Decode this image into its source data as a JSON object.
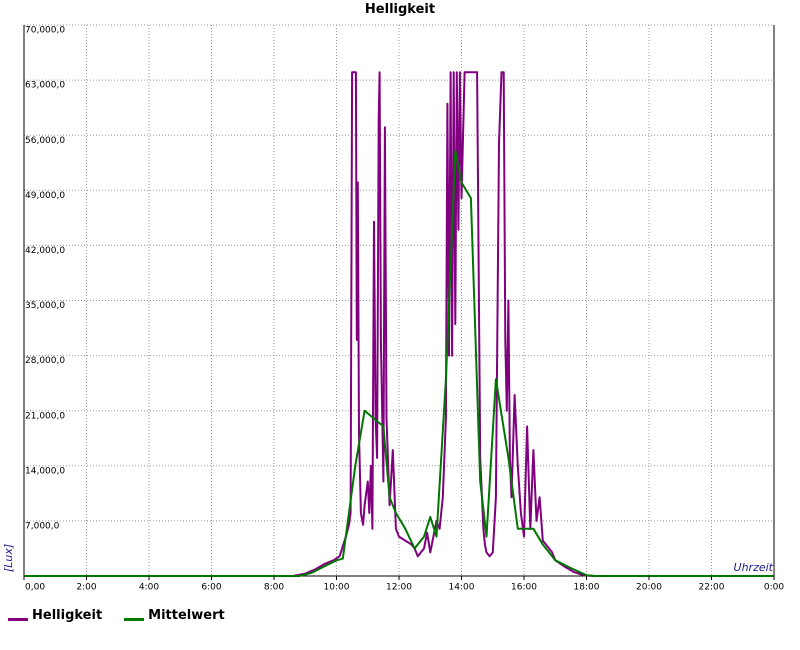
{
  "chart_data": {
    "type": "line",
    "title": "Helligkeit",
    "xlabel": "Uhrzeit",
    "ylabel": "[Lux]",
    "xlim": [
      0,
      24
    ],
    "ylim": [
      0,
      70000
    ],
    "x_ticks": [
      "0,00",
      "2:00",
      "4:00",
      "6:00",
      "8:00",
      "10:00",
      "12:00",
      "14:00",
      "16:00",
      "18:00",
      "20:00",
      "22:00",
      "0:00"
    ],
    "y_ticks": [
      "7,000,0",
      "14,000,0",
      "21,000,0",
      "28,000,0",
      "35,000,0",
      "42,000,0",
      "49,000,0",
      "56,000,0",
      "63,000,0",
      "70,000,0"
    ],
    "grid": true,
    "legend_position": "bottom-left",
    "series": [
      {
        "name": "Helligkeit",
        "color": "#800080",
        "points": [
          [
            0,
            0
          ],
          [
            8.6,
            0
          ],
          [
            9.0,
            300
          ],
          [
            9.3,
            800
          ],
          [
            9.6,
            1500
          ],
          [
            9.9,
            2000
          ],
          [
            10.1,
            2500
          ],
          [
            10.3,
            5000
          ],
          [
            10.4,
            6500
          ],
          [
            10.45,
            8000
          ],
          [
            10.5,
            64000
          ],
          [
            10.62,
            64000
          ],
          [
            10.65,
            30000
          ],
          [
            10.68,
            50000
          ],
          [
            10.72,
            18000
          ],
          [
            10.78,
            8000
          ],
          [
            10.85,
            6500
          ],
          [
            10.9,
            9000
          ],
          [
            11.0,
            12000
          ],
          [
            11.05,
            8000
          ],
          [
            11.1,
            14000
          ],
          [
            11.15,
            6000
          ],
          [
            11.2,
            45000
          ],
          [
            11.25,
            20000
          ],
          [
            11.3,
            15000
          ],
          [
            11.35,
            58000
          ],
          [
            11.38,
            64000
          ],
          [
            11.42,
            30000
          ],
          [
            11.5,
            12000
          ],
          [
            11.55,
            57000
          ],
          [
            11.6,
            20000
          ],
          [
            11.7,
            9000
          ],
          [
            11.8,
            16000
          ],
          [
            11.9,
            6000
          ],
          [
            12.0,
            5000
          ],
          [
            12.2,
            4500
          ],
          [
            12.4,
            4000
          ],
          [
            12.5,
            3500
          ],
          [
            12.6,
            2500
          ],
          [
            12.8,
            3500
          ],
          [
            12.9,
            5500
          ],
          [
            13.0,
            3000
          ],
          [
            13.1,
            5000
          ],
          [
            13.2,
            7000
          ],
          [
            13.3,
            6000
          ],
          [
            13.4,
            10000
          ],
          [
            13.5,
            20000
          ],
          [
            13.55,
            60000
          ],
          [
            13.6,
            28000
          ],
          [
            13.65,
            64000
          ],
          [
            13.7,
            28000
          ],
          [
            13.75,
            64000
          ],
          [
            13.8,
            32000
          ],
          [
            13.85,
            64000
          ],
          [
            13.9,
            44000
          ],
          [
            13.95,
            64000
          ],
          [
            14.0,
            48000
          ],
          [
            14.1,
            64000
          ],
          [
            14.5,
            64000
          ],
          [
            14.6,
            15000
          ],
          [
            14.7,
            6000
          ],
          [
            14.75,
            4000
          ],
          [
            14.8,
            3000
          ],
          [
            14.9,
            2500
          ],
          [
            15.0,
            3000
          ],
          [
            15.1,
            10000
          ],
          [
            15.2,
            55000
          ],
          [
            15.28,
            64000
          ],
          [
            15.35,
            64000
          ],
          [
            15.4,
            30000
          ],
          [
            15.45,
            21000
          ],
          [
            15.5,
            35000
          ],
          [
            15.55,
            15000
          ],
          [
            15.6,
            10000
          ],
          [
            15.7,
            23000
          ],
          [
            15.8,
            14000
          ],
          [
            15.9,
            8000
          ],
          [
            16.0,
            5000
          ],
          [
            16.1,
            19000
          ],
          [
            16.2,
            6000
          ],
          [
            16.3,
            16000
          ],
          [
            16.4,
            7000
          ],
          [
            16.5,
            10000
          ],
          [
            16.6,
            4500
          ],
          [
            16.7,
            4000
          ],
          [
            16.9,
            3000
          ],
          [
            17.0,
            2000
          ],
          [
            17.3,
            1200
          ],
          [
            17.6,
            500
          ],
          [
            17.9,
            100
          ],
          [
            18.2,
            0
          ],
          [
            24.0,
            0
          ]
        ]
      },
      {
        "name": "Mittelwert",
        "color": "#007700",
        "points": [
          [
            0,
            0
          ],
          [
            8.8,
            0
          ],
          [
            9.2,
            400
          ],
          [
            9.5,
            1000
          ],
          [
            10.0,
            2000
          ],
          [
            10.2,
            2200
          ],
          [
            10.6,
            14000
          ],
          [
            10.9,
            21000
          ],
          [
            11.2,
            20000
          ],
          [
            11.5,
            19000
          ],
          [
            11.7,
            10000
          ],
          [
            11.9,
            8000
          ],
          [
            12.2,
            6000
          ],
          [
            12.5,
            3500
          ],
          [
            12.8,
            5000
          ],
          [
            13.0,
            7500
          ],
          [
            13.2,
            5000
          ],
          [
            13.5,
            25000
          ],
          [
            13.8,
            54000
          ],
          [
            14.0,
            50000
          ],
          [
            14.3,
            48000
          ],
          [
            14.6,
            12000
          ],
          [
            14.8,
            5000
          ],
          [
            15.1,
            25000
          ],
          [
            15.5,
            15000
          ],
          [
            15.8,
            6000
          ],
          [
            16.3,
            6000
          ],
          [
            16.6,
            4000
          ],
          [
            17.0,
            2000
          ],
          [
            17.5,
            1000
          ],
          [
            18.0,
            100
          ],
          [
            18.3,
            0
          ],
          [
            24.0,
            0
          ]
        ]
      }
    ]
  }
}
